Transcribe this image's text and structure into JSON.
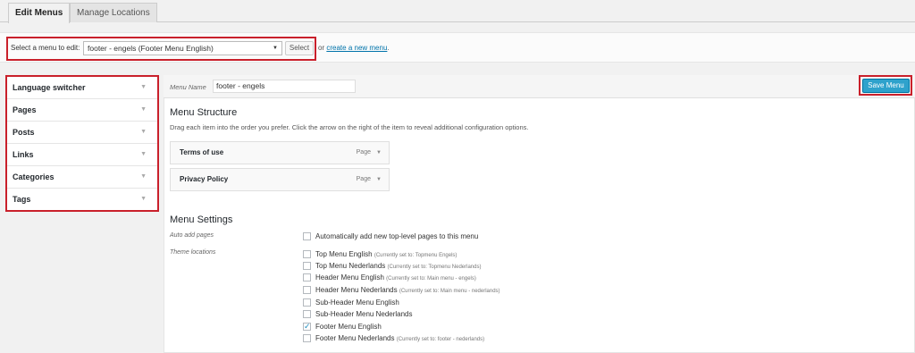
{
  "tabs": [
    {
      "label": "Edit Menus",
      "active": true
    },
    {
      "label": "Manage Locations",
      "active": false
    }
  ],
  "select_bar": {
    "label": "Select a menu to edit:",
    "selected": "footer - engels (Footer Menu English)",
    "button": "Select",
    "or_text": "or",
    "link": "create a new menu",
    "period": "."
  },
  "accordion": [
    "Language switcher",
    "Pages",
    "Posts",
    "Links",
    "Categories",
    "Tags"
  ],
  "header": {
    "menu_name_label": "Menu Name",
    "menu_name_value": "footer - engels",
    "save_label": "Save Menu"
  },
  "structure": {
    "title": "Menu Structure",
    "description": "Drag each item into the order you prefer. Click the arrow on the right of the item to reveal additional configuration options.",
    "items": [
      {
        "title": "Terms of use",
        "type": "Page"
      },
      {
        "title": "Privacy Policy",
        "type": "Page"
      }
    ]
  },
  "settings": {
    "title": "Menu Settings",
    "auto_add_label": "Auto add pages",
    "auto_add_option": "Automatically add new top-level pages to this menu",
    "theme_locations_label": "Theme locations",
    "locations": [
      {
        "name": "Top Menu English",
        "note": "(Currently set to: Topmenu Engels)",
        "checked": false
      },
      {
        "name": "Top Menu Nederlands",
        "note": "(Currently set to: Topmenu Nederlands)",
        "checked": false
      },
      {
        "name": "Header Menu English",
        "note": "(Currently set to: Main menu - engels)",
        "checked": false
      },
      {
        "name": "Header Menu Nederlands",
        "note": "(Currently set to: Main menu - nederlands)",
        "checked": false
      },
      {
        "name": "Sub-Header Menu English",
        "note": "",
        "checked": false
      },
      {
        "name": "Sub-Header Menu Nederlands",
        "note": "",
        "checked": false
      },
      {
        "name": "Footer Menu English",
        "note": "",
        "checked": true
      },
      {
        "name": "Footer Menu Nederlands",
        "note": "(Currently set to: footer - nederlands)",
        "checked": false
      }
    ]
  },
  "colors": {
    "highlight": "#c9202b",
    "primary_button": "#2ea2cc",
    "link": "#0073aa"
  }
}
